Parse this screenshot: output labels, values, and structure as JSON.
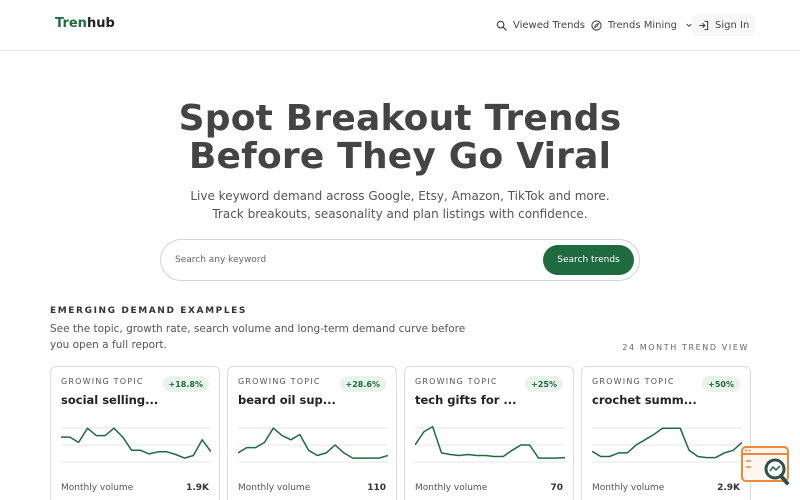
{
  "nav": {
    "logo_part1": "Tren",
    "logo_part2": "hub",
    "viewed_trends": "Viewed Trends",
    "trends_mining": "Trends Mining",
    "sign_in": "Sign In"
  },
  "hero": {
    "title_line1": "Spot Breakout Trends",
    "title_line2": "Before They Go Viral",
    "subtitle_line1": "Live keyword demand across Google, Etsy, Amazon, TikTok and more.",
    "subtitle_line2": "Track breakouts, seasonality and plan listings with confidence."
  },
  "search": {
    "placeholder": "Search any keyword",
    "button_label": "Search trends"
  },
  "examples": {
    "heading": "EMERGING DEMAND EXAMPLES",
    "description": "See the topic, growth rate, search volume and long-term demand curve before you open a full report.",
    "view_label": "24 MONTH TREND VIEW",
    "cards": [
      {
        "eyebrow": "GROWING TOPIC",
        "badge": "+18.8%",
        "title": "social selling...",
        "volume_label": "Monthly volume",
        "volume_value": "1.9K",
        "trend": [
          55,
          55,
          45,
          72,
          58,
          58,
          72,
          55,
          30,
          30,
          23,
          27,
          27,
          22,
          15,
          20,
          50,
          27
        ]
      },
      {
        "eyebrow": "GROWING TOPIC",
        "badge": "+28.6%",
        "title": "beard oil sup...",
        "volume_label": "Monthly volume",
        "volume_value": "110",
        "trend": [
          25,
          35,
          35,
          45,
          72,
          58,
          50,
          60,
          30,
          20,
          25,
          40,
          25,
          15,
          15,
          15,
          15,
          20
        ]
      },
      {
        "eyebrow": "GROWING TOPIC",
        "badge": "+25%",
        "title": "tech gifts for ...",
        "volume_label": "Monthly volume",
        "volume_value": "70",
        "trend": [
          40,
          65,
          75,
          25,
          22,
          20,
          22,
          20,
          20,
          18,
          18,
          30,
          40,
          40,
          15,
          15,
          15,
          16
        ]
      },
      {
        "eyebrow": "GROWING TOPIC",
        "badge": "+50%",
        "title": "crochet summ...",
        "volume_label": "Monthly volume",
        "volume_value": "2.9K",
        "trend": [
          28,
          18,
          18,
          25,
          25,
          40,
          50,
          60,
          72,
          72,
          72,
          30,
          18,
          16,
          16,
          25,
          30,
          45
        ]
      }
    ]
  }
}
